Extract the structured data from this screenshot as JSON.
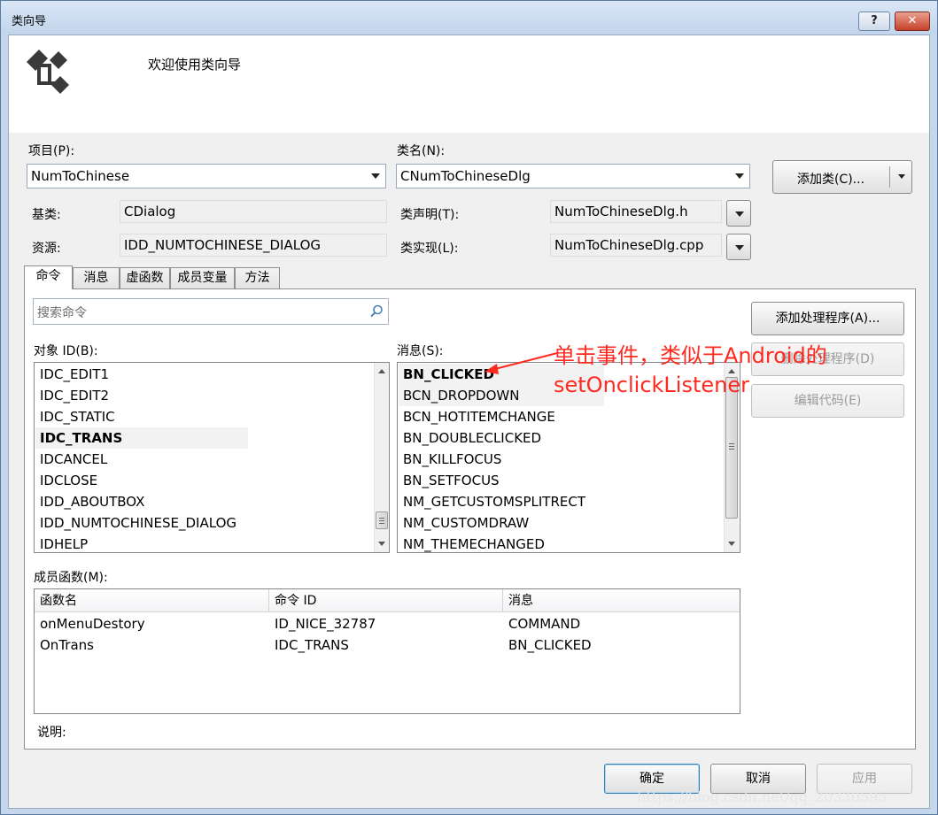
{
  "window": {
    "title": "类向导",
    "help_label": "?",
    "close_label": "✕"
  },
  "header": {
    "welcome": "欢迎使用类向导",
    "icon": "class-wizard-icon"
  },
  "project": {
    "label": "项目(P):",
    "value": "NumToChinese"
  },
  "classname": {
    "label": "类名(N):",
    "value": "CNumToChineseDlg"
  },
  "add_class_button": "添加类(C)...",
  "base_class": {
    "label": "基类:",
    "value": "CDialog"
  },
  "resource": {
    "label": "资源:",
    "value": "IDD_NUMTOCHINESE_DIALOG"
  },
  "class_decl": {
    "label": "类声明(T):",
    "value": "NumToChineseDlg.h"
  },
  "class_impl": {
    "label": "类实现(L):",
    "value": "NumToChineseDlg.cpp"
  },
  "tabs": [
    "命令",
    "消息",
    "虚函数",
    "成员变量",
    "方法"
  ],
  "search": {
    "placeholder": "搜索命令"
  },
  "object_ids": {
    "label": "对象 ID(B):",
    "items": [
      "IDC_EDIT1",
      "IDC_EDIT2",
      "IDC_STATIC",
      "IDC_TRANS",
      "IDCANCEL",
      "IDCLOSE",
      "IDD_ABOUTBOX",
      "IDD_NUMTOCHINESE_DIALOG",
      "IDHELP"
    ],
    "selected": "IDC_TRANS"
  },
  "messages": {
    "label": "消息(S):",
    "items": [
      "BN_CLICKED",
      "BCN_DROPDOWN",
      "BCN_HOTITEMCHANGE",
      "BN_DOUBLECLICKED",
      "BN_KILLFOCUS",
      "BN_SETFOCUS",
      "NM_GETCUSTOMSPLITRECT",
      "NM_CUSTOMDRAW",
      "NM_THEMECHANGED"
    ],
    "selected": "BN_CLICKED"
  },
  "side_buttons": {
    "add_handler": "添加处理程序(A)...",
    "delete_handler": "删除处理程序(D)",
    "edit_code": "编辑代码(E)"
  },
  "members": {
    "label": "成员函数(M):",
    "columns": [
      "函数名",
      "命令 ID",
      "消息"
    ],
    "rows": [
      [
        "onMenuDestory",
        "ID_NICE_32787",
        "COMMAND"
      ],
      [
        "OnTrans",
        "IDC_TRANS",
        "BN_CLICKED"
      ]
    ]
  },
  "description_label": "说明:",
  "footer": {
    "ok": "确定",
    "cancel": "取消",
    "apply": "应用"
  },
  "annotation": {
    "line1": "单击事件，类似于Android的",
    "line2": "setOnclickListener",
    "color": "#ff2a1f"
  },
  "watermark": "https://blog.csdn.net/qq_20330595"
}
